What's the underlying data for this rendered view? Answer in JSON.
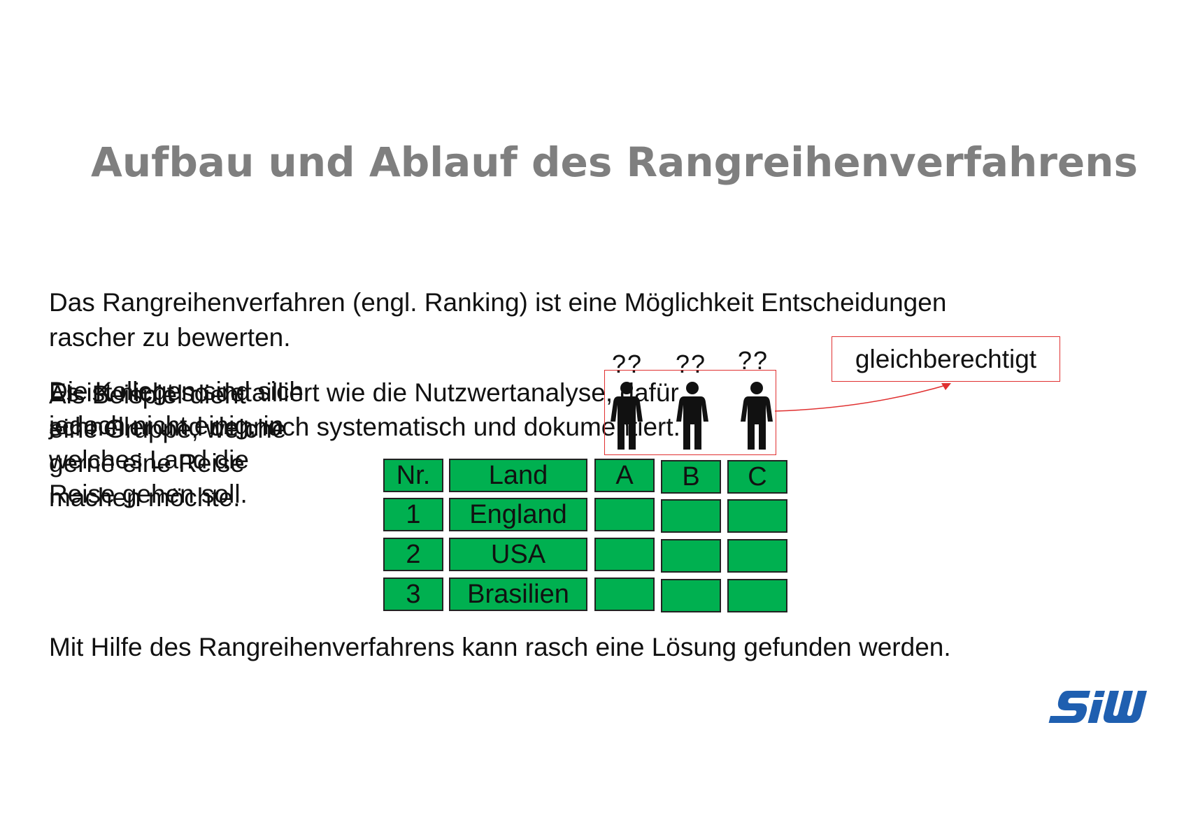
{
  "slide": {
    "title": "Aufbau und Ablauf des Rangreihenverfahrens",
    "intro_line1": "Das Rangreihenverfahren (engl. Ranking) ist eine Möglichkeit Entscheidungen",
    "intro_line2": "rascher zu bewerten.",
    "overlap_layers": [
      [
        "Die Kollegen sind sich",
        "jedoch nicht einig, in",
        "welches Land die",
        "Reise gehen soll."
      ],
      [
        "Als Beispiel dient",
        "eine Gruppe, welche",
        "gerne eine Reise",
        "machen möchte."
      ],
      [
        "Es ist nicht so detailliert wie die Nutzwertanalyse, dafür",
        "schneller und dennoch systematisch und dokumentiert."
      ]
    ],
    "conclusion": "Mit Hilfe des Rangreihenverfahrens kann rasch eine Lösung gefunden werden.",
    "logo_text": "SiW"
  },
  "people": {
    "question_marks": [
      "??",
      "??",
      "??"
    ],
    "label": "gleichberechtigt"
  },
  "table": {
    "headers": [
      "Nr.",
      "Land",
      "A",
      "B",
      "C"
    ],
    "rows": [
      {
        "nr": "1",
        "land": "England",
        "a": "",
        "b": "",
        "c": ""
      },
      {
        "nr": "2",
        "land": "USA",
        "a": "",
        "b": "",
        "c": ""
      },
      {
        "nr": "3",
        "land": "Brasilien",
        "a": "",
        "b": "",
        "c": ""
      }
    ]
  },
  "colors": {
    "title": "#7f7f7f",
    "cell_green": "#00b050",
    "accent_red": "#e03030",
    "logo_blue": "#1f5fb0"
  },
  "icons": [
    "person-icon",
    "siw-logo"
  ]
}
